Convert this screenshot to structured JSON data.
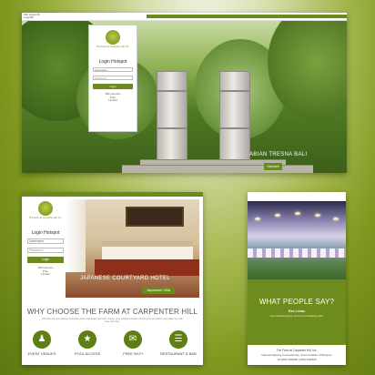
{
  "colors": {
    "brand_green": "#6a8a1c",
    "background": "#7f981f"
  },
  "desktop": {
    "top_left_text": [
      "Wifi (Hotel B)",
      "Login(B)"
    ],
    "login": {
      "logo_text": "The Farm at Carpenter Hill, Inc.",
      "title": "Login Hotspot",
      "username_value": "Username",
      "password_placeholder": "Password",
      "button_label": "Login",
      "note_lines": [
        "WiFi Service",
        "Free",
        "Limited"
      ]
    },
    "caption": "ABIAN TRESNA BALI",
    "caption_button": "Venues"
  },
  "tablet": {
    "login": {
      "logo_text": "The Farm at Carpenter Hill, Inc.",
      "title": "Login Hotspot",
      "username_value": "Username",
      "password_placeholder": "Password",
      "button_label": "Login",
      "note_lines": [
        "WiFi Service",
        "Free",
        "Limited"
      ]
    },
    "caption": "JAPANESE COURTYARD HOTEL",
    "caption_button": "Japanese Villa",
    "heading": "WHY CHOOSE THE FARM AT CARPENTER HILL",
    "subtext": "Whether you are seeking tranquility and a well-deserved inner respite, your wellness needs of body and soul will be especially met with love and care.",
    "features": [
      {
        "icon": "people-icon",
        "label": "EVENT VENUES"
      },
      {
        "icon": "star-icon",
        "label": "POOL ACCESS"
      },
      {
        "icon": "chat-icon",
        "label": "FREE WI-FI"
      },
      {
        "icon": "restaurant-icon",
        "label": "RESTAURANT & BAR"
      }
    ]
  },
  "phone": {
    "heading": "WHAT PEOPLE SAY?",
    "name": "Ere Lelau",
    "quote": "\"very peaceful place, and accommodating staff.\"",
    "footer_lines": [
      "The Farm at Carpenter Hill, Inc.",
      "National Highway, Koronadal City, South Cotabato, Philippines",
      "Tel:(083) 2282838 | (083) 2282835"
    ]
  }
}
